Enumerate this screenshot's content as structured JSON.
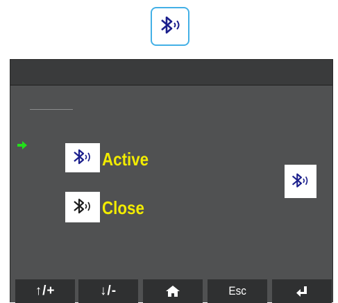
{
  "title_icon": "bluetooth-icon",
  "menu": {
    "items": [
      {
        "label": "Active",
        "icon": "bluetooth-icon",
        "selected": true
      },
      {
        "label": "Close",
        "icon": "bluetooth-icon",
        "selected": false
      }
    ],
    "selection_indicator": "arrow-right-icon",
    "side_icon": "bluetooth-icon"
  },
  "softkeys": [
    {
      "label": "↑/+",
      "icon": "up-plus-icon"
    },
    {
      "label": "↓/-",
      "icon": "down-minus-icon"
    },
    {
      "label": "",
      "icon": "home-icon"
    },
    {
      "label": "Esc",
      "icon": ""
    },
    {
      "label": "",
      "icon": "enter-icon"
    }
  ],
  "colors": {
    "accent_border": "#43b0e6",
    "bluetooth_icon": "#1a1e8c",
    "label_text": "#f2ec00",
    "selection_arrow": "#22e01a",
    "screen_background": "#505152",
    "softkey_background": "#2f3031"
  }
}
